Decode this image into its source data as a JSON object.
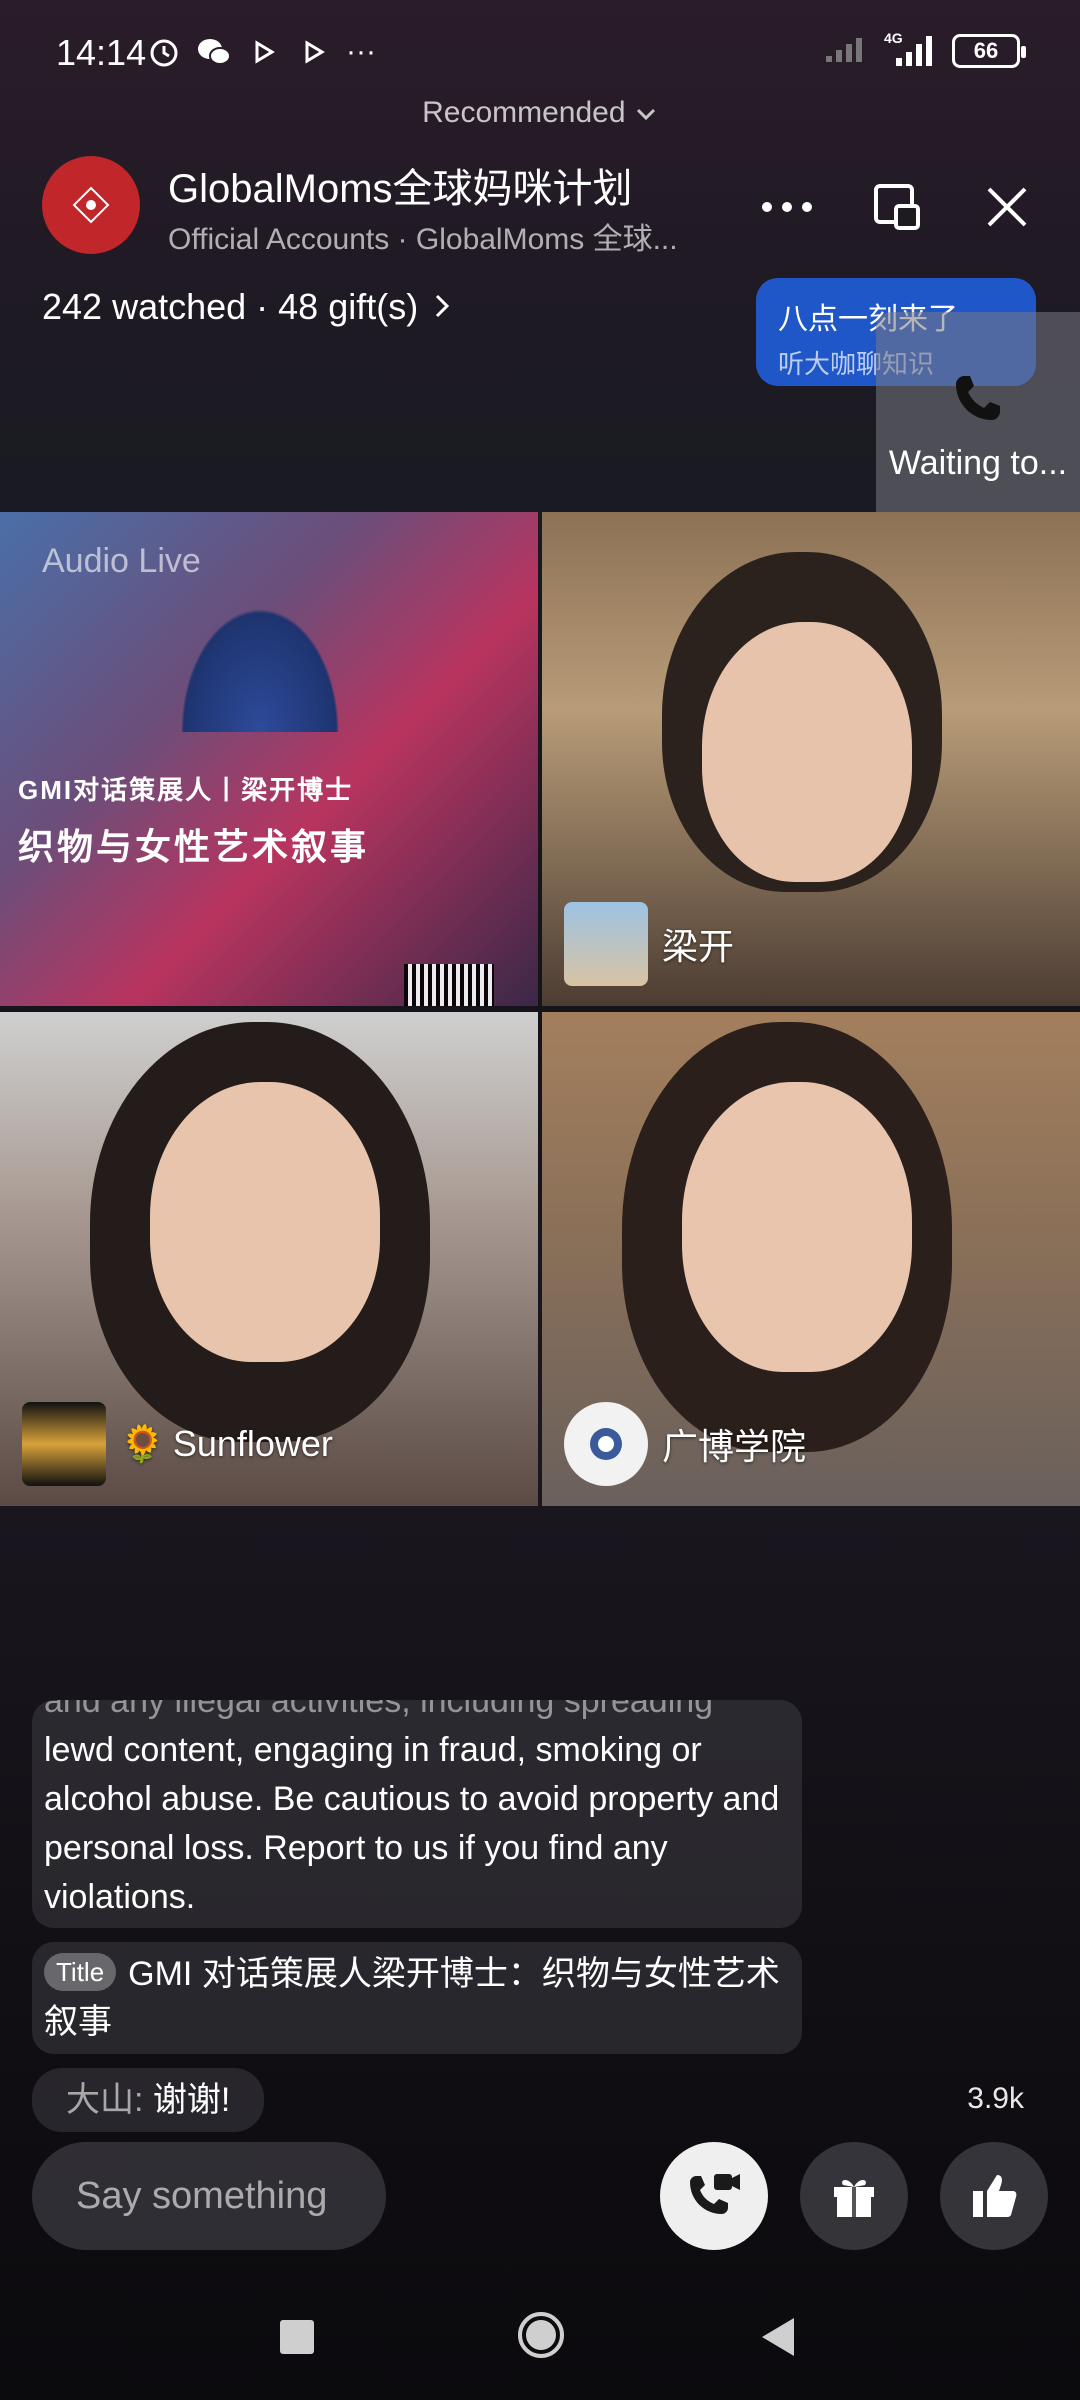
{
  "status_bar": {
    "time": "14:14",
    "network": "4G",
    "battery": "66",
    "more": "···"
  },
  "recommended": {
    "label": "Recommended"
  },
  "header": {
    "title": "GlobalMoms全球妈咪计划",
    "subtitle": "Official Accounts · GlobalMoms 全球..."
  },
  "stats": {
    "text": "242 watched · 48 gift(s)"
  },
  "promo": {
    "line1": "八点一刻来了",
    "line2": "听大咖聊知识"
  },
  "waiting": {
    "label": "Waiting to..."
  },
  "tiles": {
    "poster": {
      "audio_live": "Audio Live",
      "title1": "GMI对话策展人丨梁开博士",
      "title2": "织物与女性艺术叙事"
    },
    "tile2": {
      "name": "梁开"
    },
    "tile3": {
      "name": "Sunflower",
      "emoji": "🌻"
    },
    "tile4": {
      "name": "广博学院"
    }
  },
  "chat": {
    "notice_partial": "and any illegal activities, including spreading",
    "notice": "lewd content, engaging in fraud, smoking or alcohol abuse. Be cautious to avoid property and personal loss. Report to us if you find any violations.",
    "title_badge": "Title",
    "title_text": "GMI 对话策展人梁开博士：织物与女性艺术叙事",
    "user_name": "大山:",
    "user_text": " 谢谢!"
  },
  "like_count": "3.9k",
  "composer": {
    "placeholder": "Say something"
  },
  "colors": {
    "brand_red": "#c0262a",
    "promo_blue": "#1f57c9",
    "call_button": "#efefef"
  }
}
